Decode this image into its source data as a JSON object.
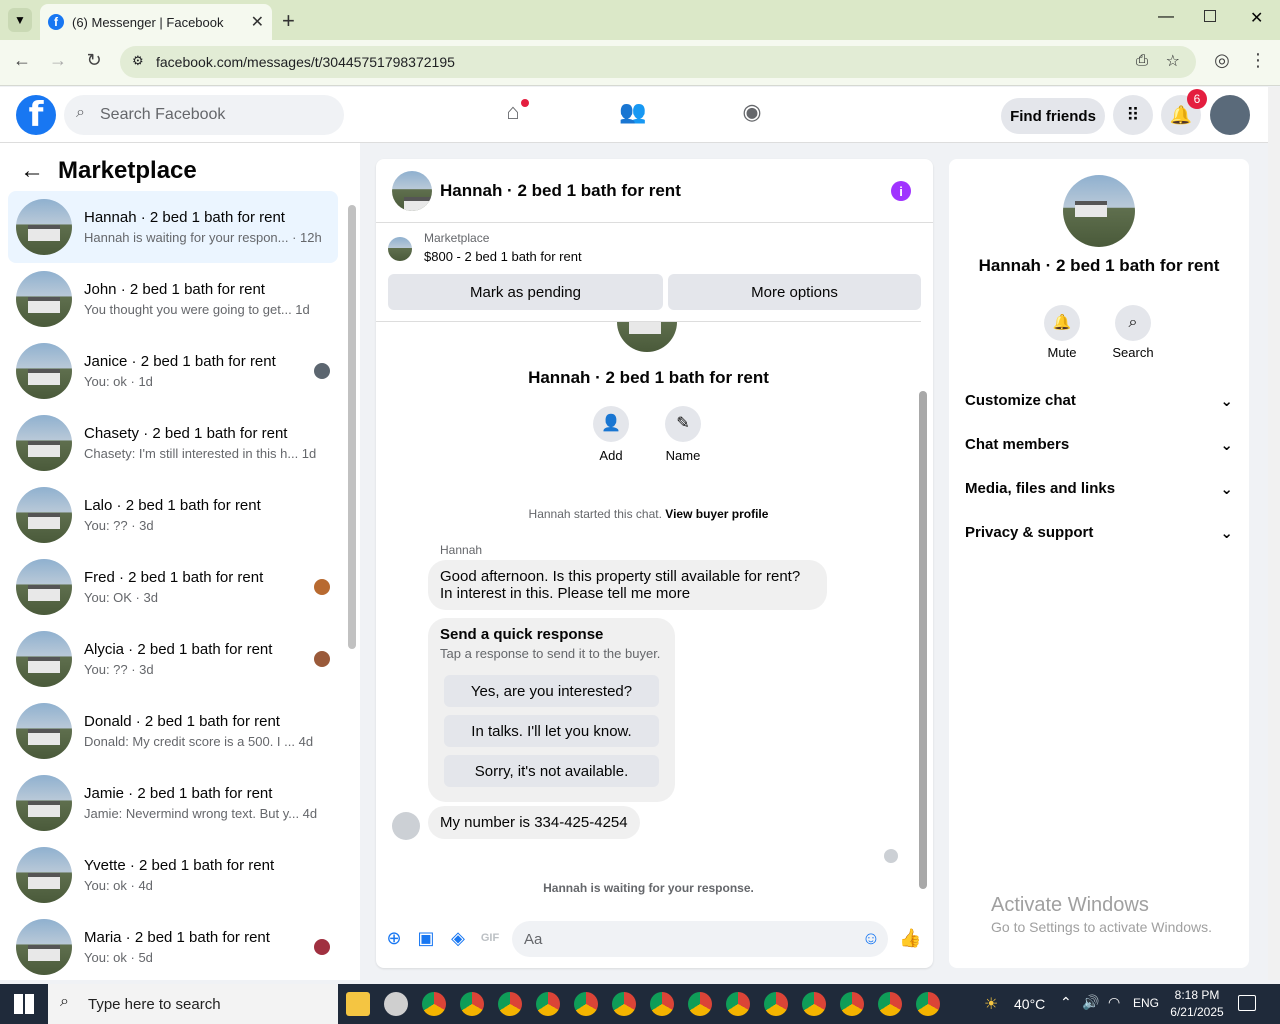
{
  "browser": {
    "tab_title": "(6) Messenger | Facebook",
    "url": "facebook.com/messages/t/30445751798372195"
  },
  "header": {
    "search_placeholder": "Search Facebook",
    "find_friends": "Find friends",
    "notification_count": "6"
  },
  "left": {
    "title": "Marketplace",
    "conversations": [
      {
        "name": "Hannah · 2 bed 1 bath for rent",
        "preview": "Hannah is waiting for your respon... · 12h",
        "active": true
      },
      {
        "name": "John · 2 bed 1 bath for rent",
        "preview": "You thought you were going to get...  1d"
      },
      {
        "name": "Janice · 2 bed 1 bath for rent",
        "preview": "You: ok · 1d"
      },
      {
        "name": "Chasety · 2 bed 1 bath for rent",
        "preview": "Chasety: I'm still interested in this h...  1d"
      },
      {
        "name": "Lalo · 2 bed 1 bath for rent",
        "preview": "You: ?? · 3d"
      },
      {
        "name": "Fred · 2 bed 1 bath for rent",
        "preview": "You: OK · 3d"
      },
      {
        "name": "Alycia · 2 bed 1 bath for rent",
        "preview": "You: ?? · 3d"
      },
      {
        "name": "Donald · 2 bed 1 bath for rent",
        "preview": "Donald: My credit score is a 500. I ...  4d"
      },
      {
        "name": "Jamie · 2 bed 1 bath for rent",
        "preview": "Jamie: Nevermind wrong text. But y...  4d"
      },
      {
        "name": "Yvette · 2 bed 1 bath for rent",
        "preview": "You: ok · 4d"
      },
      {
        "name": "Maria · 2 bed 1 bath for rent",
        "preview": "You: ok · 5d"
      }
    ]
  },
  "chat": {
    "title": "Hannah · 2 bed 1 bath for rent",
    "listing_label": "Marketplace",
    "listing_price": "$800 - 2 bed 1 bath for rent",
    "mark_pending": "Mark as pending",
    "more_options": "More options",
    "profile_name": "Hannah · 2 bed 1 bath for rent",
    "add_label": "Add",
    "name_label": "Name",
    "started_text": "Hannah started this chat.",
    "view_profile": "View buyer profile",
    "sender": "Hannah",
    "msg1_line1": "Good afternoon. Is this property still available for rent?",
    "msg1_line2": "In interest in this. Please tell me more",
    "quick_title": "Send a quick response",
    "quick_sub": "Tap a response to send it to the buyer.",
    "quick1": "Yes, are you interested?",
    "quick2": "In talks. I'll let you know.",
    "quick3": "Sorry, it's not available.",
    "msg2": "My number is 334-425-4254",
    "waiting": "Hannah is waiting for your response.",
    "input_placeholder": "Aa"
  },
  "right": {
    "name": "Hannah · 2 bed 1 bath for rent",
    "mute": "Mute",
    "search": "Search",
    "sections": [
      "Customize chat",
      "Chat members",
      "Media, files and links",
      "Privacy & support"
    ]
  },
  "watermark": {
    "title": "Activate Windows",
    "sub": "Go to Settings to activate Windows."
  },
  "taskbar": {
    "search_placeholder": "Type here to search",
    "weather": "40°C",
    "lang": "ENG",
    "time": "8:18 PM",
    "date": "6/21/2025"
  }
}
